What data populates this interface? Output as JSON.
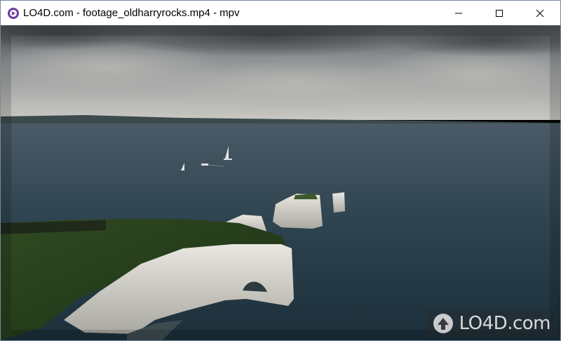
{
  "window": {
    "title": "LO4D.com - footage_oldharryrocks.mp4 - mpv",
    "app_icon": "mpv-icon",
    "controls": {
      "minimize": "minimize-icon",
      "maximize": "maximize-icon",
      "close": "close-icon"
    }
  },
  "video": {
    "content": "aerial-sea-cliffs-footage"
  },
  "watermark": {
    "text": "LO4D.com"
  }
}
